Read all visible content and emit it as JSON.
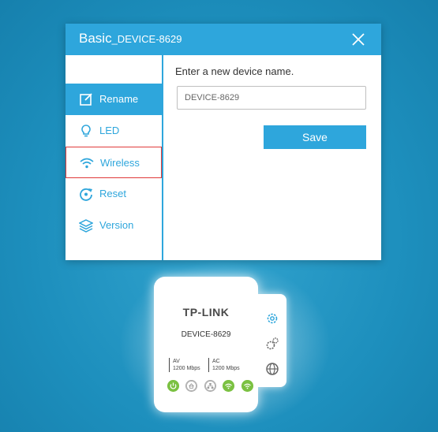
{
  "dialog": {
    "title": "Basic",
    "title_suffix": "_DEVICE-8629",
    "close_label": "×"
  },
  "sidebar": {
    "items": [
      {
        "label": "Rename",
        "icon": "edit-icon",
        "active": true
      },
      {
        "label": "LED",
        "icon": "bulb-icon"
      },
      {
        "label": "Wireless",
        "icon": "wifi-icon",
        "highlighted": true
      },
      {
        "label": "Reset",
        "icon": "reset-icon"
      },
      {
        "label": "Version",
        "icon": "layers-icon"
      }
    ]
  },
  "main": {
    "prompt": "Enter a new device name.",
    "name_value": "DEVICE-8629",
    "save_label": "Save"
  },
  "device": {
    "brand": "TP-LINK",
    "name": "DEVICE-8629",
    "spec_av_label": "AV",
    "spec_av_speed": "1200 Mbps",
    "spec_ac_label": "AC",
    "spec_ac_speed": "1200 Mbps",
    "leds": [
      "power-icon",
      "home-icon",
      "ethernet-icon",
      "wifi-icon",
      "wifi-icon"
    ],
    "side_icons": [
      "gear-icon",
      "gears-icon",
      "globe-icon"
    ]
  },
  "colors": {
    "accent": "#2ea6dc",
    "background": "#1d8fbd",
    "highlight_border": "#e03a3a",
    "led_green": "#7bc142"
  }
}
